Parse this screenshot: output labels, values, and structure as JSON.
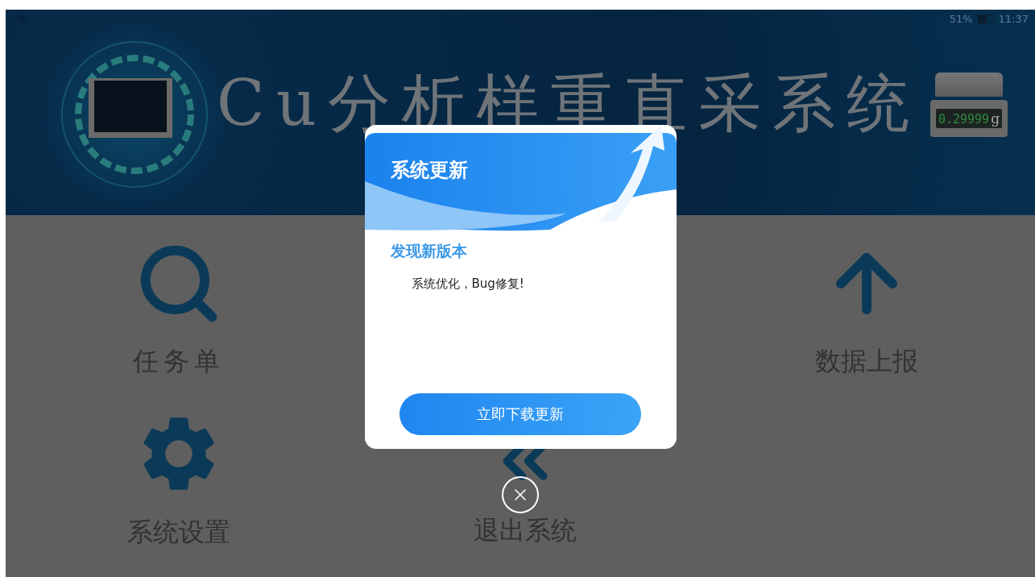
{
  "status_bar": {
    "battery": "51%",
    "time": "11:37"
  },
  "banner": {
    "title": "Cu分析样重直采系统",
    "scale_reading": "0.29999",
    "scale_unit": "g"
  },
  "menu": [
    {
      "kind": "search",
      "label": "任务单"
    },
    {
      "kind": "upload",
      "label": "数据上报"
    },
    {
      "kind": "settings",
      "label": "系统设置"
    },
    {
      "kind": "exit",
      "label": "退出系统"
    }
  ],
  "dialog": {
    "title": "系统更新",
    "subtitle": "发现新版本",
    "message": "系统优化，Bug修复!",
    "button": "立即下载更新"
  }
}
